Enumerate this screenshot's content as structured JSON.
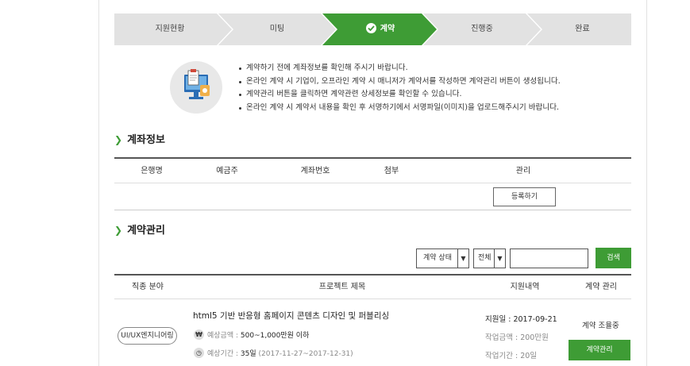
{
  "steps": [
    {
      "label": "지원현황",
      "active": false
    },
    {
      "label": "미팅",
      "active": false
    },
    {
      "label": "계약",
      "active": true
    },
    {
      "label": "진행중",
      "active": false
    },
    {
      "label": "완료",
      "active": false
    }
  ],
  "notice": [
    "계약하기 전에 계좌정보를 확인해 주시기 바랍니다.",
    "온라인 계약 시 기업이, 오프라인 계약 시 매니저가 계약서를 작성하면 계약관리 버튼이 생성됩니다.",
    "계약관리 버튼을 클릭하면 계약관련 상세정보를 확인할 수 있습니다.",
    "온라인 계약 시 계약서 내용을 확인 후 서명하기에서 서명파일(이미지)을 업로드해주시기 바랍니다."
  ],
  "account_section": {
    "title": "계좌정보",
    "columns": [
      "은행명",
      "예금주",
      "계좌번호",
      "첨부",
      "관리"
    ],
    "register_button": "등록하기"
  },
  "contract_section": {
    "title": "계약관리",
    "filters": {
      "status_select": "계약 상태",
      "scope_select": "전체",
      "search_value": "",
      "search_button": "검색"
    },
    "columns": [
      "직종 분야",
      "프로젝트 제목",
      "지원내역",
      "계약 관리"
    ],
    "rows": [
      {
        "field": "UI/UX엔지니어링",
        "title": "html5 기반 반응형 홈페이지 콘텐츠 디자인 및 퍼블리싱",
        "amount_label": "예상금액 :",
        "amount_value": "500~1,000만원 이하",
        "period_label": "예상기간 :",
        "period_days": "35일",
        "period_range": "(2017-11-27~2017-12-31)",
        "apply_date": "지원일 : 2017-09-21",
        "work_amount": "작업금액 : 200만원",
        "work_period": "작업기간 : 20일",
        "status": "계약 조율중",
        "manage_button": "계약관리"
      }
    ]
  },
  "colors": {
    "accent": "#3e9c35",
    "step_inactive": "#e2e2e2"
  },
  "icons": {
    "step_check": "check-circle-icon",
    "section_arrow": "chevron-right-icon",
    "amount": "won-icon",
    "period": "clock-icon"
  }
}
